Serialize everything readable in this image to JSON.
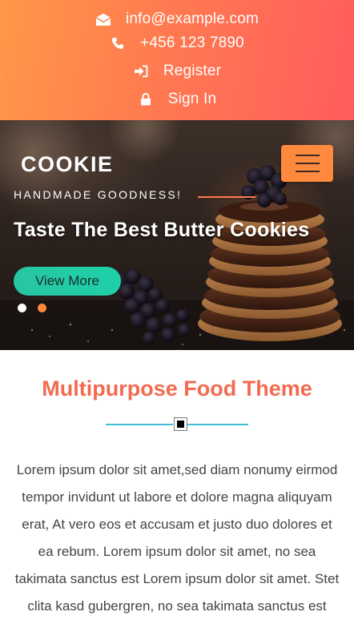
{
  "topbar": {
    "email": "info@example.com",
    "phone": "+456 123 7890",
    "register_label": "Register",
    "signin_label": "Sign In"
  },
  "hero": {
    "brand": "COOKIE",
    "tagline": "HANDMADE  GOODNESS!",
    "title": "Taste The Best Butter Cookies",
    "cta_label": "View More",
    "slides_count": 2,
    "active_slide": 2
  },
  "content": {
    "title": "Multipurpose Food Theme",
    "body": "Lorem ipsum dolor sit amet,sed diam nonumy eirmod tempor invidunt ut labore et dolore magna aliquyam erat, At vero eos et accusam et justo duo dolores et ea rebum. Lorem ipsum dolor sit amet, no sea takimata sanctus est Lorem ipsum dolor sit amet. Stet clita kasd gubergren, no sea takimata sanctus est"
  },
  "colors": {
    "topbar_gradient_start": "#ff9848",
    "topbar_gradient_end": "#ff5c5e",
    "accent_orange": "#ff8a3d",
    "cta_teal": "#27c6a2",
    "title_coral": "#f26b50",
    "divider_cyan": "#3fc0d4"
  },
  "icons": {
    "email": "envelope-icon",
    "phone": "phone-icon",
    "register": "sign-in-arrow-icon",
    "signin": "lock-icon",
    "menu": "hamburger-icon"
  }
}
